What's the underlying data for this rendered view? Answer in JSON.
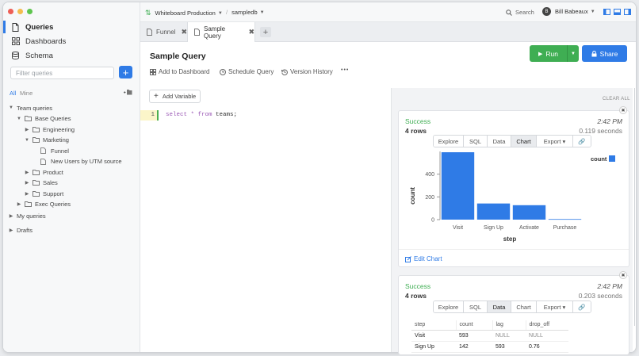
{
  "sidebar": {
    "nav": [
      {
        "label": "Queries",
        "icon": "file-icon",
        "active": true
      },
      {
        "label": "Dashboards",
        "icon": "grid-icon",
        "active": false
      },
      {
        "label": "Schema",
        "icon": "database-icon",
        "active": false
      }
    ],
    "filter_placeholder": "Filter queries",
    "add_label": "+",
    "seg_all": "All",
    "seg_mine": "Mine",
    "tree": [
      {
        "label": "Team queries",
        "level": 0,
        "expanded": true,
        "type": "section"
      },
      {
        "label": "Base Queries",
        "level": 1,
        "expanded": true,
        "type": "folder"
      },
      {
        "label": "Engineering",
        "level": 2,
        "expanded": false,
        "type": "folder"
      },
      {
        "label": "Marketing",
        "level": 2,
        "expanded": true,
        "type": "folder"
      },
      {
        "label": "Funnel",
        "level": 3,
        "type": "file"
      },
      {
        "label": "New Users by UTM source",
        "level": 3,
        "type": "file"
      },
      {
        "label": "Product",
        "level": 2,
        "expanded": false,
        "type": "folder"
      },
      {
        "label": "Sales",
        "level": 2,
        "expanded": false,
        "type": "folder"
      },
      {
        "label": "Support",
        "level": 2,
        "expanded": false,
        "type": "folder"
      },
      {
        "label": "Exec Queries",
        "level": 1,
        "expanded": false,
        "type": "folder"
      }
    ],
    "my_queries": "My queries",
    "drafts": "Drafts"
  },
  "topbar": {
    "connection": "Whiteboard Production",
    "database": "sampledb",
    "search_label": "Search",
    "user_initial": "B",
    "user_name": "Bill Babeaux"
  },
  "tabs": [
    {
      "label": "Funnel",
      "active": false
    },
    {
      "label": "Sample Query",
      "active": true
    }
  ],
  "query": {
    "title": "Sample Query",
    "actions": [
      "Add to Dashboard",
      "Schedule Query",
      "Version History"
    ],
    "more": "•••",
    "run_label": "Run",
    "share_label": "Share",
    "add_variable": "Add Variable",
    "line_number": "1",
    "code": {
      "kw1": "select",
      "star": " * ",
      "kw2": "from",
      "table": " teams;"
    }
  },
  "results": {
    "clear_all": "CLEAR ALL",
    "cards": [
      {
        "status": "Success",
        "rows": "4 rows",
        "time": "2:42 PM",
        "duration": "0.119 seconds",
        "buttons": [
          "Explore",
          "SQL",
          "Data",
          "Chart",
          "Export ▾",
          "🔗"
        ],
        "active": "Chart",
        "edit_chart": "Edit Chart"
      },
      {
        "status": "Success",
        "rows": "4 rows",
        "time": "2:42 PM",
        "duration": "0.203 seconds",
        "buttons": [
          "Explore",
          "SQL",
          "Data",
          "Chart",
          "Export ▾",
          "🔗"
        ],
        "active": "Data",
        "table": {
          "columns": [
            "step",
            "count",
            "lag",
            "drop_off"
          ],
          "rows": [
            [
              "Visit",
              "593",
              "NULL",
              "NULL"
            ],
            [
              "Sign Up",
              "142",
              "593",
              "0.76"
            ]
          ]
        }
      }
    ]
  },
  "chart_data": {
    "type": "bar",
    "categories": [
      "Visit",
      "Sign Up",
      "Activate",
      "Purchase"
    ],
    "series": [
      {
        "name": "count",
        "values": [
          593,
          142,
          127,
          5
        ]
      }
    ],
    "xlabel": "step",
    "ylabel": "count",
    "ylim": [
      0,
      600
    ],
    "yticks": [
      0,
      200,
      400
    ],
    "legend": "top-right",
    "color": "#2f7be6"
  },
  "colors": {
    "accent": "#2f7be6",
    "success": "#3fae53"
  }
}
